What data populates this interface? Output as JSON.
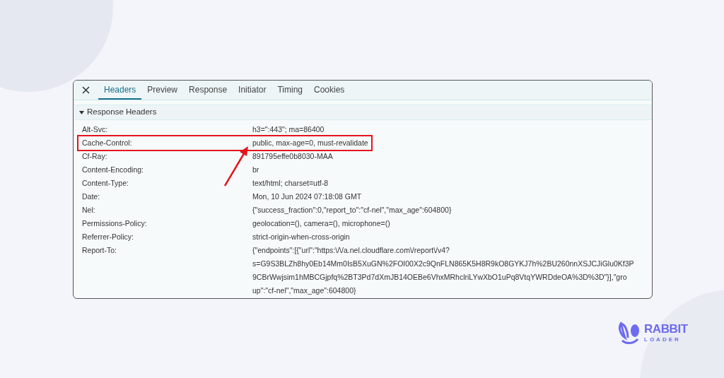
{
  "tabs": [
    {
      "label": "Headers",
      "selected": true
    },
    {
      "label": "Preview",
      "selected": false
    },
    {
      "label": "Response",
      "selected": false
    },
    {
      "label": "Initiator",
      "selected": false
    },
    {
      "label": "Timing",
      "selected": false
    },
    {
      "label": "Cookies",
      "selected": false
    }
  ],
  "section": {
    "title": "Response Headers",
    "expanded": true
  },
  "headers": [
    {
      "name": "Alt-Svc:",
      "lines": [
        "h3=\":443\"; ma=86400"
      ],
      "highlighted": false
    },
    {
      "name": "Cache-Control:",
      "lines": [
        "public, max-age=0, must-revalidate"
      ],
      "highlighted": true
    },
    {
      "name": "Cf-Ray:",
      "lines": [
        "891795effe0b8030-MAA"
      ],
      "highlighted": false
    },
    {
      "name": "Content-Encoding:",
      "lines": [
        "br"
      ],
      "highlighted": false
    },
    {
      "name": "Content-Type:",
      "lines": [
        "text/html; charset=utf-8"
      ],
      "highlighted": false
    },
    {
      "name": "Date:",
      "lines": [
        "Mon, 10 Jun 2024 07:18:08 GMT"
      ],
      "highlighted": false
    },
    {
      "name": "Nel:",
      "lines": [
        "{\"success_fraction\":0,\"report_to\":\"cf-nel\",\"max_age\":604800}"
      ],
      "highlighted": false
    },
    {
      "name": "Permissions-Policy:",
      "lines": [
        "geolocation=(), camera=(), microphone=()"
      ],
      "highlighted": false
    },
    {
      "name": "Referrer-Policy:",
      "lines": [
        "strict-origin-when-cross-origin"
      ],
      "highlighted": false
    },
    {
      "name": "Report-To:",
      "lines": [
        "{\"endpoints\":[{\"url\":\"https:\\/\\/a.nel.cloudflare.com\\/report\\/v4?",
        "s=G9S3BLZh8hy0Eb14Mm0IsB5XuGN%2FOI00X2c9QnFLN865K5H8R9kO8GYKJ7h%2BU260nnXSJCJiGlu0Kf3P",
        "9CBrWwjsim1hMBCGjpfq%2BT3Pd7dXmJB14OEBe6VhxMRhclriLYwXbO1uPq8VtqYWRDdeOA%3D%3D\"}],\"gro",
        "up\":\"cf-nel\",\"max_age\":604800}"
      ],
      "highlighted": false
    }
  ],
  "logo": {
    "line_1": "RABBIT",
    "line_2": "LOADER"
  }
}
